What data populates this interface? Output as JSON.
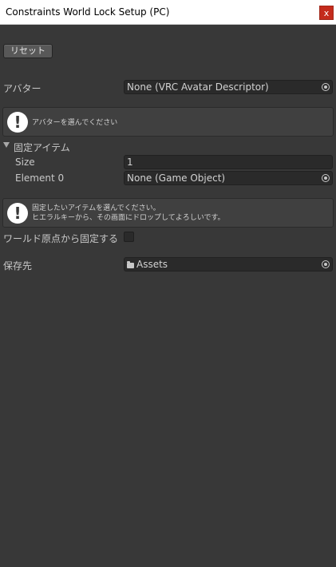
{
  "window": {
    "title": "Constraints World Lock Setup (PC)",
    "close_label": "x"
  },
  "toolbar": {
    "reset_label": "リセット"
  },
  "avatar": {
    "label": "アバター",
    "value": "None (VRC Avatar Descriptor)",
    "help": "アバターを選んでください"
  },
  "fixed_items": {
    "label": "固定アイテム",
    "expanded": true,
    "size_label": "Size",
    "size_value": "1",
    "element0_label": "Element 0",
    "element0_value": "None (Game Object)",
    "help_line1": "固定したいアイテムを選んでください。",
    "help_line2": "ヒエラルキーから、その画面にドロップしてよろしいです。"
  },
  "world_origin": {
    "label": "ワールド原点から固定する",
    "checked": false
  },
  "save_location": {
    "label": "保存先",
    "value": "Assets"
  },
  "icons": {
    "help": "info-exclamation-icon",
    "picker": "object-picker-icon",
    "folder": "folder-icon",
    "foldout": "foldout-triangle-icon"
  }
}
